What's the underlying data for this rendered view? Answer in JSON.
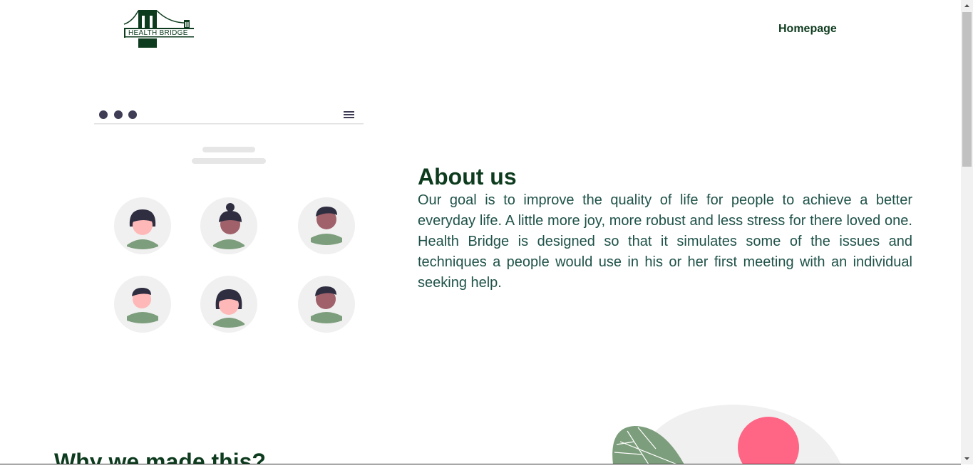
{
  "header": {
    "logo_text": "HEALTH BRIDGE",
    "nav": {
      "home_label": "Homepage"
    }
  },
  "about": {
    "title": "About us",
    "body": "Our goal is to improve the quality of life for people to achieve a better everyday life. A little more joy, more robust and less stress for there loved one. Health Bridge is designed so that it simulates some of the issues and techniques a people would use in his or her first meeting with an individual seeking help."
  },
  "why": {
    "title": "Why we made this?"
  },
  "colors": {
    "brand_dark_green": "#0d3b1e",
    "text_teal": "#1e5248",
    "accent_green": "#7d9e7c",
    "accent_pink": "#ff6584",
    "avatar_bg": "#f0f0f0",
    "dark_ink": "#3f3d56"
  },
  "icons": {
    "window_dots": "three-dots-icon",
    "menu": "hamburger-menu-icon",
    "scroll_up": "scroll-up-arrow-icon",
    "scroll_down": "scroll-down-arrow-icon"
  }
}
